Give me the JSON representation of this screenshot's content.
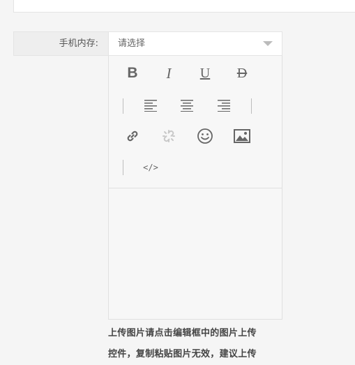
{
  "form": {
    "memory_label": "手机内存:",
    "memory_select": {
      "value": "请选择"
    }
  },
  "editor": {
    "toolbar": [
      {
        "icon": "bold-icon"
      },
      {
        "icon": "italic-icon"
      },
      {
        "icon": "underline-icon"
      },
      {
        "icon": "strikethrough-icon"
      },
      {
        "icon": "align-left-icon"
      },
      {
        "icon": "align-center-icon"
      },
      {
        "icon": "align-right-icon"
      },
      {
        "icon": "link-icon"
      },
      {
        "icon": "unlink-icon"
      },
      {
        "icon": "emoji-icon"
      },
      {
        "icon": "image-icon"
      },
      {
        "icon": "code-icon"
      }
    ],
    "toolbar_bold_glyph": "B",
    "toolbar_italic_glyph": "I",
    "toolbar_underline_glyph": "U",
    "toolbar_strike_glyph": "D",
    "toolbar_code_glyph": "</>"
  },
  "hint": {
    "line1": "上传图片请点击编辑框中的图片上传",
    "line2": "控件，复制粘贴图片无效，建议上传"
  },
  "colors": {
    "page_bg": "#f5f5f5",
    "icon": "#666666",
    "icon_disabled": "#c8c8c8"
  }
}
